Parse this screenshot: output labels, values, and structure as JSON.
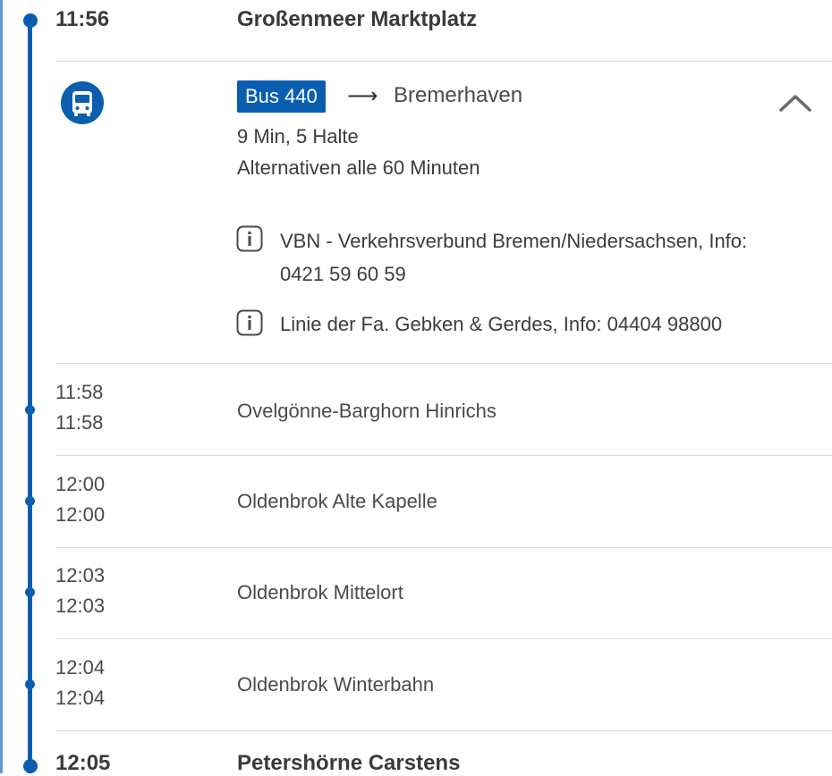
{
  "departure": {
    "time": "11:56",
    "stop": "Großenmeer Marktplatz"
  },
  "leg": {
    "icon": "bus-icon",
    "line": "Bus 440",
    "arrow": "⟶",
    "direction": "Bremerhaven",
    "duration": "9 Min, 5 Halte",
    "alternatives": "Alternativen alle 60 Minuten",
    "collapse_icon": "chevron-up-icon",
    "infos": [
      {
        "icon": "info-icon",
        "line1": "VBN - Verkehrsverbund Bremen/Niedersachsen, Info:",
        "line2": "0421 59 60 59"
      },
      {
        "icon": "info-icon",
        "line1": "Linie der Fa. Gebken & Gerdes, Info: 04404 98800"
      }
    ]
  },
  "intermediate_stops": [
    {
      "arr": "11:58",
      "dep": "11:58",
      "name": "Ovelgönne-Barghorn Hinrichs"
    },
    {
      "arr": "12:00",
      "dep": "12:00",
      "name": "Oldenbrok Alte Kapelle"
    },
    {
      "arr": "12:03",
      "dep": "12:03",
      "name": "Oldenbrok Mittelort"
    },
    {
      "arr": "12:04",
      "dep": "12:04",
      "name": "Oldenbrok Winterbahn"
    }
  ],
  "arrival": {
    "time": "12:05",
    "stop": "Petershörne Carstens"
  },
  "colors": {
    "accent": "#0a5eb0",
    "text": "#3c3c3c",
    "divider": "#dcdcdc",
    "frame": "#5a9bd8"
  }
}
